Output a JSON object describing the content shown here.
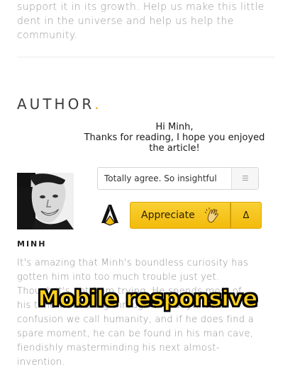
{
  "intro": {
    "lines": [
      "support it in its growth. Help us make this little",
      "dent in the universe and help us help the",
      "community."
    ]
  },
  "author_section": {
    "heading": "AUTHOR",
    "heading_dot": ".",
    "accent_color": "#f0a81e",
    "greeting": {
      "line1": "Hi Minh,",
      "line2": "Thanks for reading, I hope you enjoyed",
      "line3": "the article!"
    },
    "author_name": "MINH",
    "reaction": {
      "selected_value": "Totally agree. So insightful",
      "menu_icon": "hamburger-menu-icon"
    },
    "appreciate_button": {
      "label": "Appreciate",
      "icon": "clapping-hands-icon",
      "button_color": "#f6c520"
    },
    "count_symbol": "Δ",
    "logo_icon": "a-logo-icon",
    "bio_lines": [
      "It's amazing that Minh's boundless curiosity has",
      "gotten him into too much trouble just yet.",
      "Though it's not from trying. He spends most of",
      "his time wandering through the labyrinth of",
      "confusion we call humanity, and if he does find a",
      "spare moment, he can be found in his man cave,",
      "fiendishly masterminding his next almost-",
      "invention."
    ]
  },
  "overlay": {
    "caption": "Mobile responsive",
    "caption_color": "#ffd21a"
  }
}
